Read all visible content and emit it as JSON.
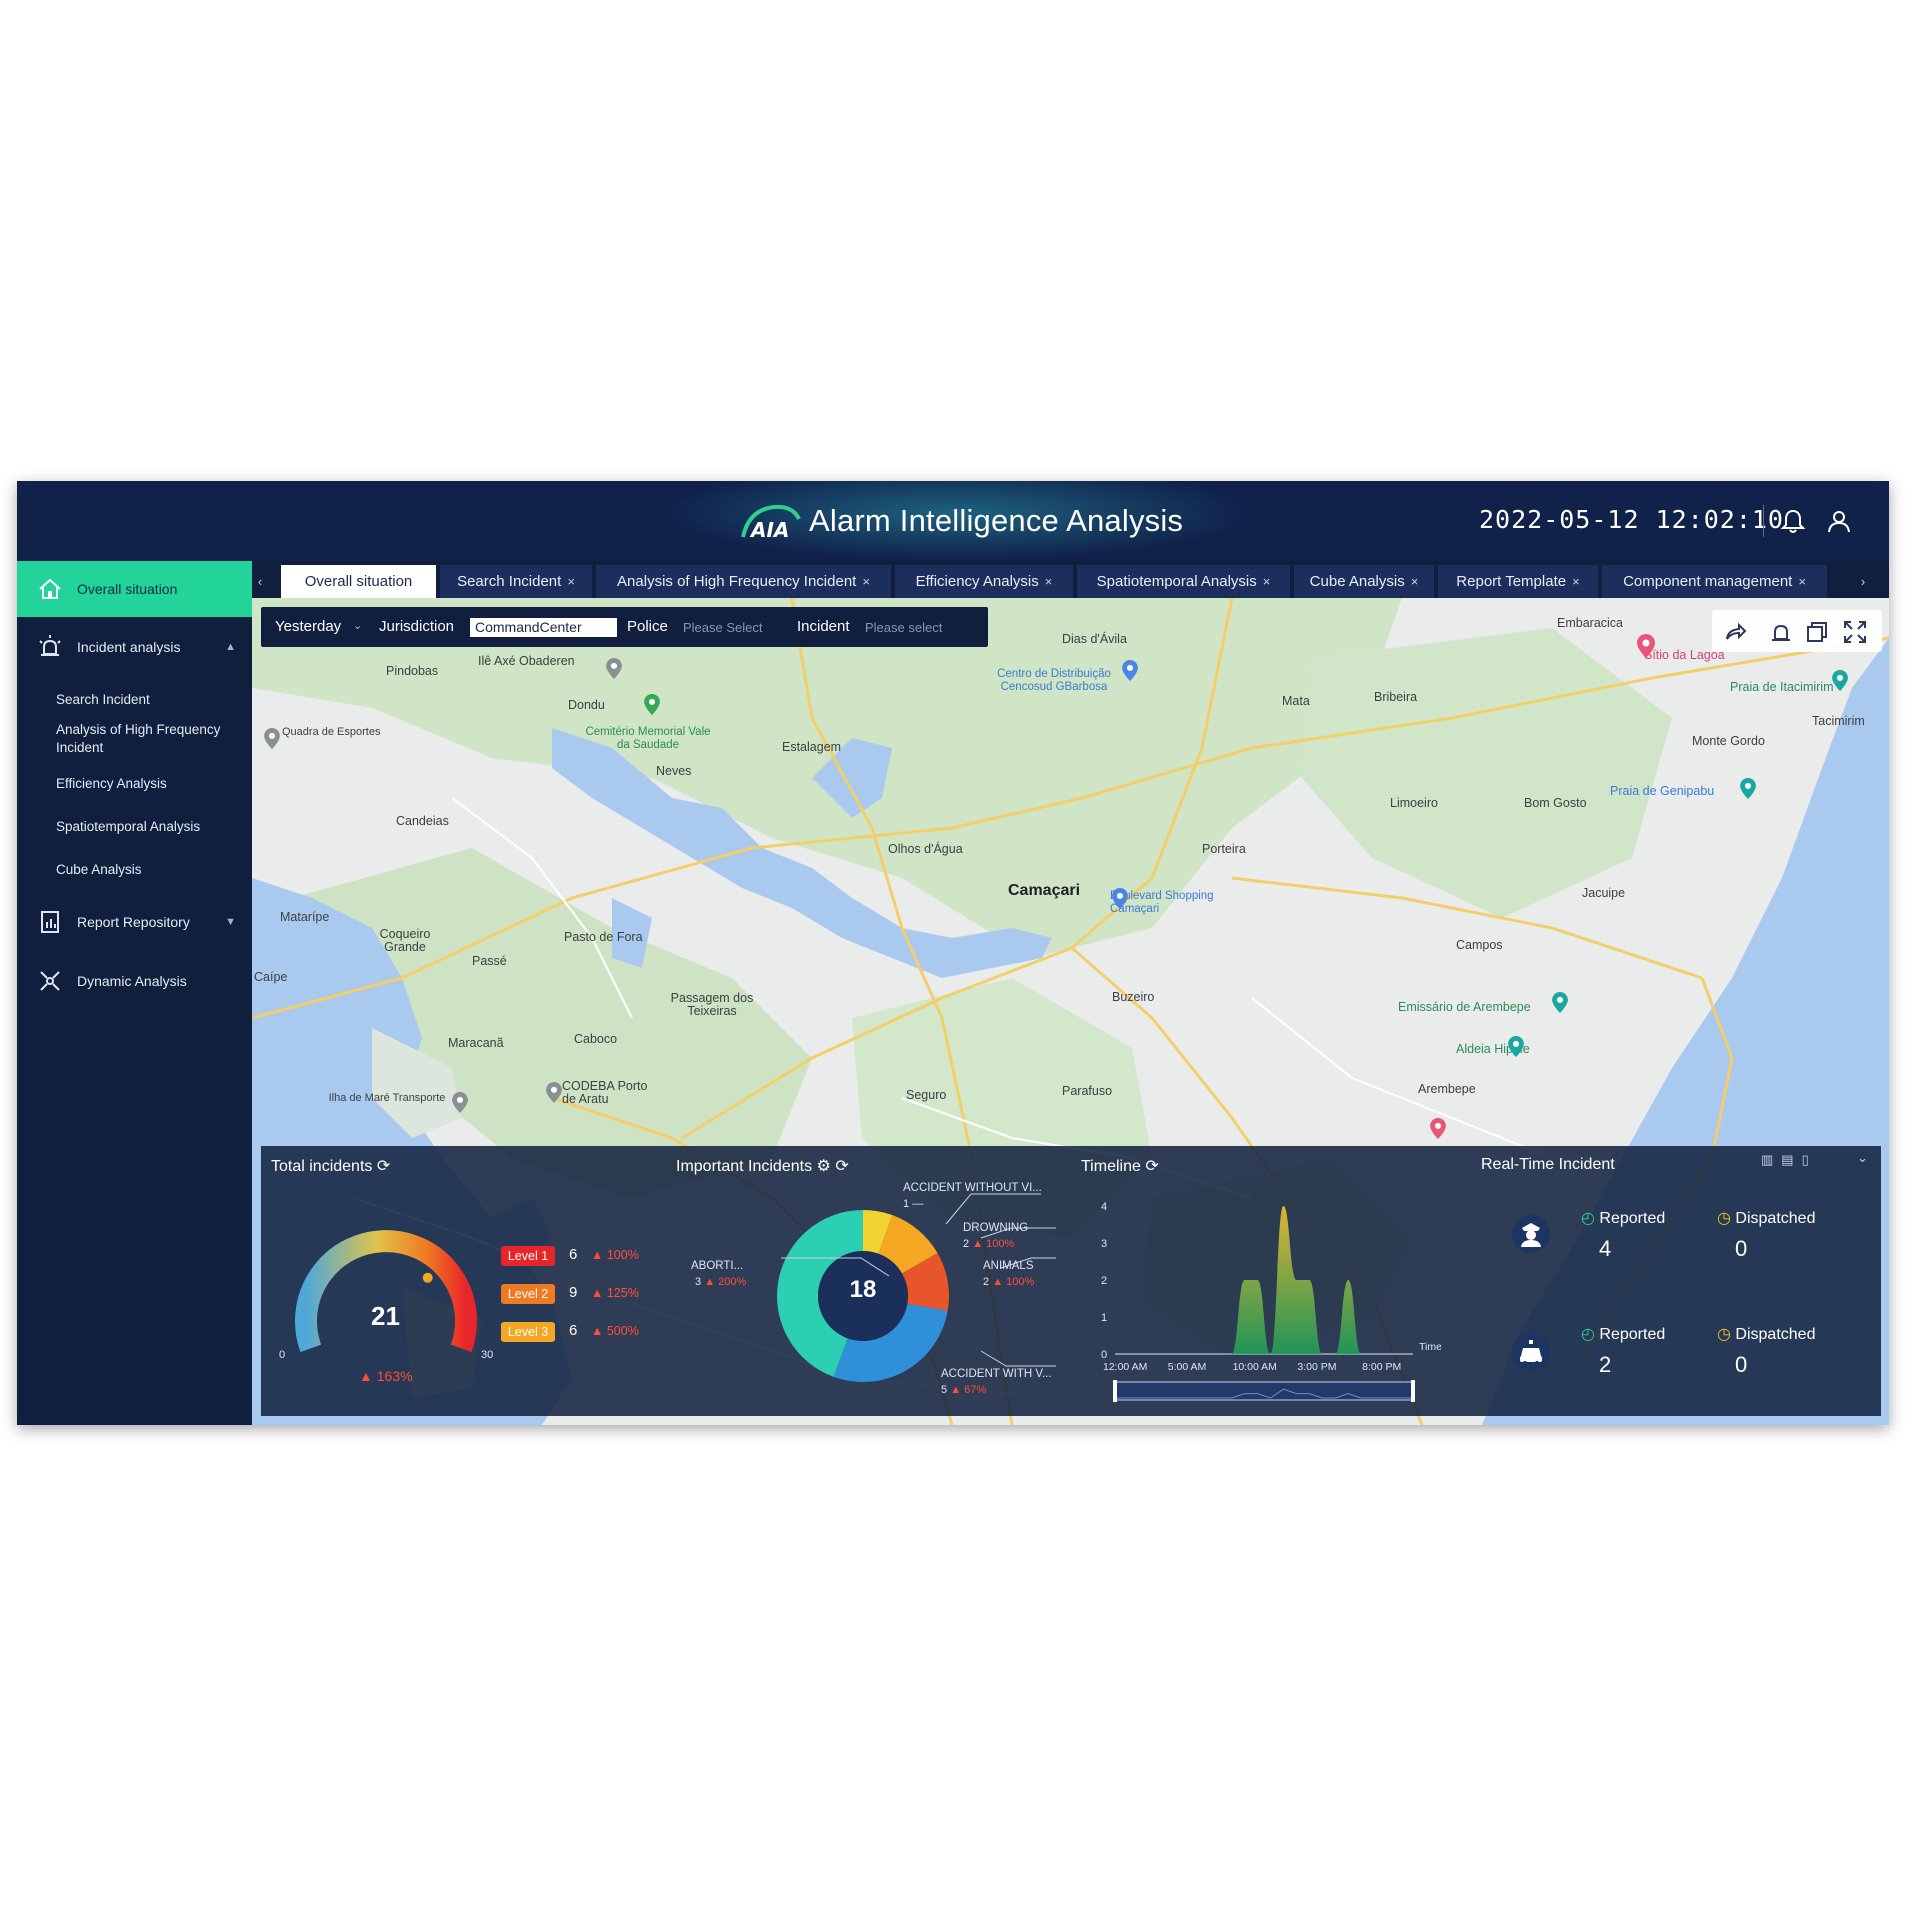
{
  "header": {
    "logo_mark": "AIA",
    "title": "Alarm Intelligence Analysis",
    "datetime": "2022-05-12 12:02:10"
  },
  "sidebar": {
    "items": [
      {
        "label": "Overall situation",
        "icon": "home-icon"
      },
      {
        "label": "Incident analysis",
        "icon": "alarm-light-icon"
      },
      {
        "label": "Report Repository",
        "icon": "report-icon"
      },
      {
        "label": "Dynamic Analysis",
        "icon": "dynamic-icon"
      }
    ],
    "sub_items": [
      "Search Incident",
      "Analysis of High Frequency Incident",
      "Efficiency Analysis",
      "Spatiotemporal Analysis",
      "Cube Analysis"
    ]
  },
  "tabs": [
    {
      "label": "Overall situation"
    },
    {
      "label": "Search Incident"
    },
    {
      "label": "Analysis of High Frequency Incident"
    },
    {
      "label": "Efficiency Analysis"
    },
    {
      "label": "Spatiotemporal Analysis"
    },
    {
      "label": "Cube Analysis"
    },
    {
      "label": "Report Template"
    },
    {
      "label": "Component management"
    }
  ],
  "filters": {
    "date": "Yesterday",
    "jurisdiction_label": "Jurisdiction",
    "jurisdiction_value": "CommandCenter",
    "police_label": "Police",
    "police_placeholder": "Please Select",
    "incident_label": "Incident",
    "incident_placeholder": "Please select"
  },
  "map": {
    "labels": [
      "Pindobas",
      "Dias d'Ávila",
      "Embaracica",
      "Sítio da Lagoa",
      "Praia de Itacimirim",
      "Tacimirim",
      "Centro de Distribuição Cencosud GBarbosa",
      "Mata",
      "Bribeira",
      "Monte Gordo",
      "Ilê Axé Obaderen",
      "Quadra de Esportes",
      "Dondu",
      "Cemitério Memorial Vale da Saudade",
      "Estalagem",
      "Neves",
      "Praia de Genipabu",
      "Limoeiro",
      "Bom Gosto",
      "Candeias",
      "Olhos d'Água",
      "Porteira",
      "Camaçari",
      "Boulevard Shopping Camaçari",
      "Jacuipe",
      "Matarípe",
      "Coqueiro Grande",
      "Passé",
      "Pasto de Fora",
      "Campos",
      "Caípe",
      "Passagem dos Teixeiras",
      "Buzeiro",
      "Emissário de Arembepe",
      "Maracanã",
      "Caboco",
      "Aldeia Hippie",
      "Arembepe",
      "CODEBA Porto de Aratu",
      "Parafuso",
      "Seguro",
      "Ilha de Maré Transporte"
    ]
  },
  "total_incidents": {
    "title": "Total incidents",
    "value": "21",
    "gauge_fraction": 0.7,
    "scale_min": "0",
    "scale_max": "30",
    "change": "▲ 163%",
    "levels": [
      {
        "label": "Level 1",
        "count": "6",
        "change": "▲ 100%",
        "color": "#e8252a"
      },
      {
        "label": "Level 2",
        "count": "9",
        "change": "▲ 125%",
        "color": "#f07a22"
      },
      {
        "label": "Level 3",
        "count": "6",
        "change": "▲ 500%",
        "color": "#f5a623"
      }
    ]
  },
  "important_incidents": {
    "title": "Important Incidents",
    "total": "18",
    "slices": [
      {
        "label": "ACCIDENT WITHOUT VI...",
        "value": 1,
        "change": "—",
        "color": "#f0d330"
      },
      {
        "label": "DROWNING",
        "value": 2,
        "change": "▲ 100%",
        "color": "#f5a623"
      },
      {
        "label": "ANIMALS",
        "value": 2,
        "change": "▲ 100%",
        "color": "#e8552a"
      },
      {
        "label": "ACCIDENT WITH V...",
        "value": 5,
        "change": "▲ 67%",
        "color": "#2f8fd8"
      },
      {
        "label": "ABORTI...",
        "value": 3,
        "change": "▲ 200%",
        "color": "#2dcfb3"
      }
    ],
    "other": {
      "value": 5,
      "color": "#2dcfb3"
    }
  },
  "timeline": {
    "title": "Timeline",
    "xaxis_title": "Time",
    "y_ticks": [
      "0",
      "1",
      "2",
      "3",
      "4"
    ],
    "x_ticks": [
      "12:00 AM",
      "5:00 AM",
      "10:00 AM",
      "3:00 PM",
      "8:00 PM"
    ],
    "chart_data": {
      "type": "area",
      "x": [
        "12:00 AM",
        "1:00 AM",
        "2:00 AM",
        "3:00 AM",
        "4:00 AM",
        "5:00 AM",
        "6:00 AM",
        "7:00 AM",
        "8:00 AM",
        "9:00 AM",
        "10:00 AM",
        "11:00 AM",
        "12:00 PM",
        "1:00 PM",
        "2:00 PM",
        "3:00 PM",
        "4:00 PM",
        "5:00 PM",
        "6:00 PM",
        "7:00 PM",
        "8:00 PM",
        "9:00 PM",
        "10:00 PM",
        "11:00 PM"
      ],
      "values": [
        0,
        0,
        0,
        0,
        0,
        0,
        0,
        0,
        0,
        0,
        2,
        2,
        0,
        4,
        2,
        2,
        0,
        0,
        2,
        0,
        0,
        0,
        0,
        0
      ],
      "ylim": [
        0,
        4
      ],
      "xlabel": "Time"
    }
  },
  "realtime": {
    "title": "Real-Time Incident",
    "rows": [
      {
        "icon": "police-officer-icon",
        "reported_label": "Reported",
        "reported": "4",
        "dispatched_label": "Dispatched",
        "dispatched": "0"
      },
      {
        "icon": "police-car-icon",
        "reported_label": "Reported",
        "reported": "2",
        "dispatched_label": "Dispatched",
        "dispatched": "0"
      }
    ]
  },
  "colors": {
    "header_bg": "#10214a",
    "sidebar_active": "#23d49a",
    "panel_bg": "#0f1f3d",
    "accent_green": "#2fd08f",
    "accent_yellow": "#f5c518"
  }
}
